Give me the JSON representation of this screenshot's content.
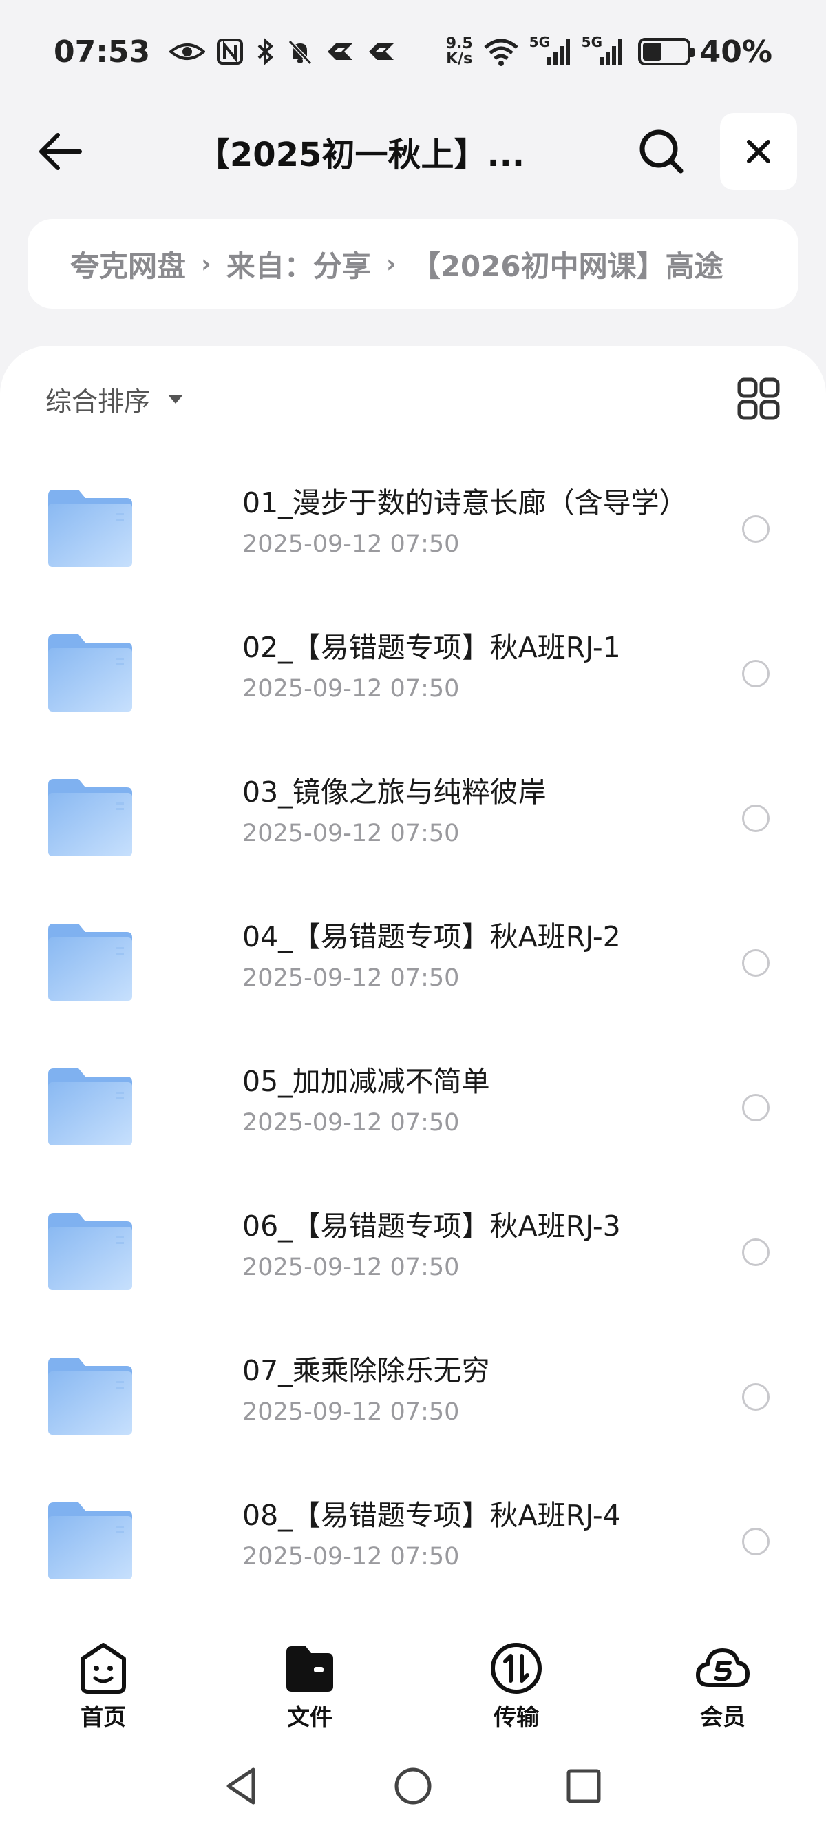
{
  "status_bar": {
    "time": "07:53",
    "net_speed_value": "9.5",
    "net_speed_unit": "K/s",
    "net1": "5G",
    "net2": "5G",
    "battery": "40%"
  },
  "header": {
    "title": "【2025初一秋上】..."
  },
  "breadcrumb": {
    "items": [
      "夸克网盘",
      "来自：分享",
      "【2026初中网课】高途"
    ]
  },
  "toolbar": {
    "sort_label": "综合排序"
  },
  "files": [
    {
      "name": "01_漫步于数的诗意长廊（含导学）",
      "date": "2025-09-12 07:50"
    },
    {
      "name": "02_【易错题专项】秋A班RJ-1",
      "date": "2025-09-12 07:50"
    },
    {
      "name": "03_镜像之旅与纯粹彼岸",
      "date": "2025-09-12 07:50"
    },
    {
      "name": "04_【易错题专项】秋A班RJ-2",
      "date": "2025-09-12 07:50"
    },
    {
      "name": "05_加加减减不简单",
      "date": "2025-09-12 07:50"
    },
    {
      "name": "06_【易错题专项】秋A班RJ-3",
      "date": "2025-09-12 07:50"
    },
    {
      "name": "07_乘乘除除乐无穷",
      "date": "2025-09-12 07:50"
    },
    {
      "name": "08_【易错题专项】秋A班RJ-4",
      "date": "2025-09-12 07:50"
    }
  ],
  "bottom_nav": [
    {
      "label": "首页",
      "icon": "home-smile-icon"
    },
    {
      "label": "文件",
      "icon": "folder-icon"
    },
    {
      "label": "传输",
      "icon": "transfer-icon"
    },
    {
      "label": "会员",
      "icon": "member-cloud-icon"
    }
  ],
  "colors": {
    "folder_light": "#bcd9fb",
    "folder_dark": "#7fb1f0",
    "accent": "#111111"
  }
}
